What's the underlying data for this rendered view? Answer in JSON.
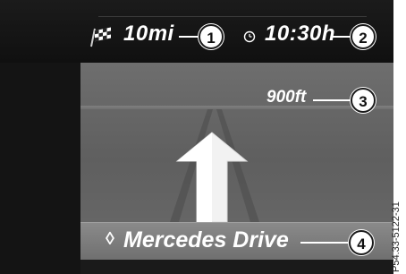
{
  "trip": {
    "distance_to_destination": "10mi",
    "arrival_time": "10:30h"
  },
  "maneuver": {
    "distance_to_turn": "900ft"
  },
  "street": {
    "name": "Mercedes Drive",
    "marker": "◊"
  },
  "callouts": [
    "1",
    "2",
    "3",
    "4"
  ],
  "icons": {
    "destination": "checkered-flag-icon",
    "clock": "clock-icon",
    "maneuver": "straight-arrow-icon"
  },
  "figure_code": "P54.33-5122-31",
  "colors": {
    "background": "#141414",
    "road": "#6e6e6e",
    "text": "#ffffff"
  }
}
